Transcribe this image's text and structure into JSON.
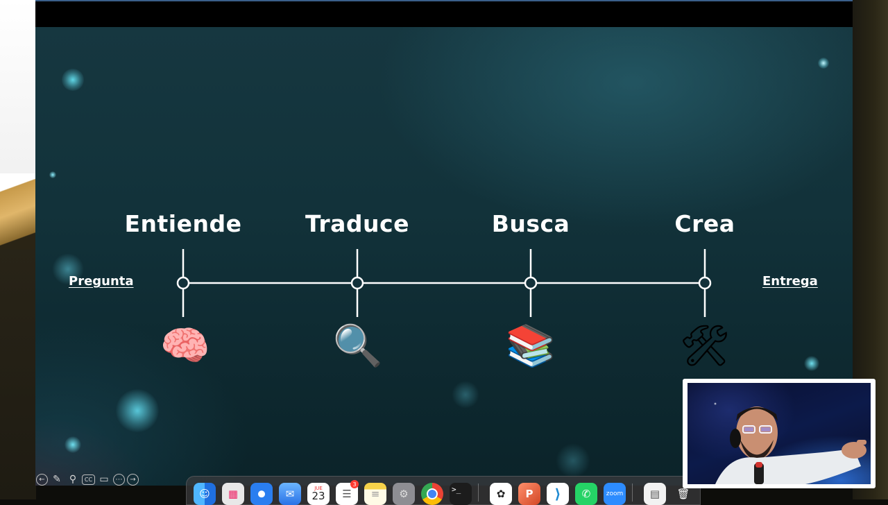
{
  "slide": {
    "start_label": "Pregunta",
    "end_label": "Entrega",
    "stages": [
      {
        "title": "Entiende",
        "icon": "brain-icon",
        "glyph": "🧠"
      },
      {
        "title": "Traduce",
        "icon": "magnifying-glass-icon",
        "glyph": "🔍"
      },
      {
        "title": "Busca",
        "icon": "books-icon",
        "glyph": "📚"
      },
      {
        "title": "Crea",
        "icon": "hammer-and-wrench-icon",
        "glyph": "🛠"
      }
    ]
  },
  "slide_controls": [
    {
      "icon": "previous-slide-icon",
      "glyph": "←"
    },
    {
      "icon": "pen-icon",
      "glyph": "✎"
    },
    {
      "icon": "zoom-icon",
      "glyph": "⚲"
    },
    {
      "icon": "captions-icon",
      "glyph": "CC"
    },
    {
      "icon": "camera-icon",
      "glyph": "▭"
    },
    {
      "icon": "more-options-icon",
      "glyph": "⋯"
    },
    {
      "icon": "next-slide-icon",
      "glyph": "→"
    }
  ],
  "dock": {
    "apps": [
      {
        "name": "finder-icon",
        "glyph": "☺",
        "color": "#2f8ff0"
      },
      {
        "name": "launchpad-icon",
        "glyph": "▦",
        "color": "#e8e8e8"
      },
      {
        "name": "safari-icon",
        "glyph": "⊕",
        "color": "#2a7ef0"
      },
      {
        "name": "mail-icon",
        "glyph": "✉",
        "color": "#3b8cf2"
      },
      {
        "name": "calendar-icon",
        "glyph": "23",
        "sub": "JUE",
        "color": "#ffffff"
      },
      {
        "name": "reminders-icon",
        "glyph": "☰",
        "color": "#ffffff",
        "badge": "3"
      },
      {
        "name": "notes-icon",
        "glyph": "≡",
        "color": "#f7d24a"
      },
      {
        "name": "system-settings-icon",
        "glyph": "⚙",
        "color": "#8e8e93"
      },
      {
        "name": "chrome-icon",
        "glyph": "◉",
        "color": "#ffffff"
      },
      {
        "name": "terminal-icon",
        "glyph": ">_",
        "color": "#1c1c1c"
      },
      {
        "name": "chatgpt-icon",
        "glyph": "✿",
        "color": "#ffffff"
      },
      {
        "name": "powerpoint-icon",
        "glyph": "P",
        "color": "#d24726"
      },
      {
        "name": "vscode-icon",
        "glyph": "⟩",
        "color": "#1f8ad2"
      },
      {
        "name": "whatsapp-icon",
        "glyph": "✆",
        "color": "#25d366"
      },
      {
        "name": "zoom-app-icon",
        "glyph": "zoom",
        "color": "#2d8cff"
      },
      {
        "name": "documents-stack-icon",
        "glyph": "▤",
        "color": "#f2f2f2"
      },
      {
        "name": "trash-icon",
        "glyph": "🗑",
        "color": "#cfcfcf"
      }
    ]
  },
  "webcam": {
    "label": "presenter-webcam"
  }
}
